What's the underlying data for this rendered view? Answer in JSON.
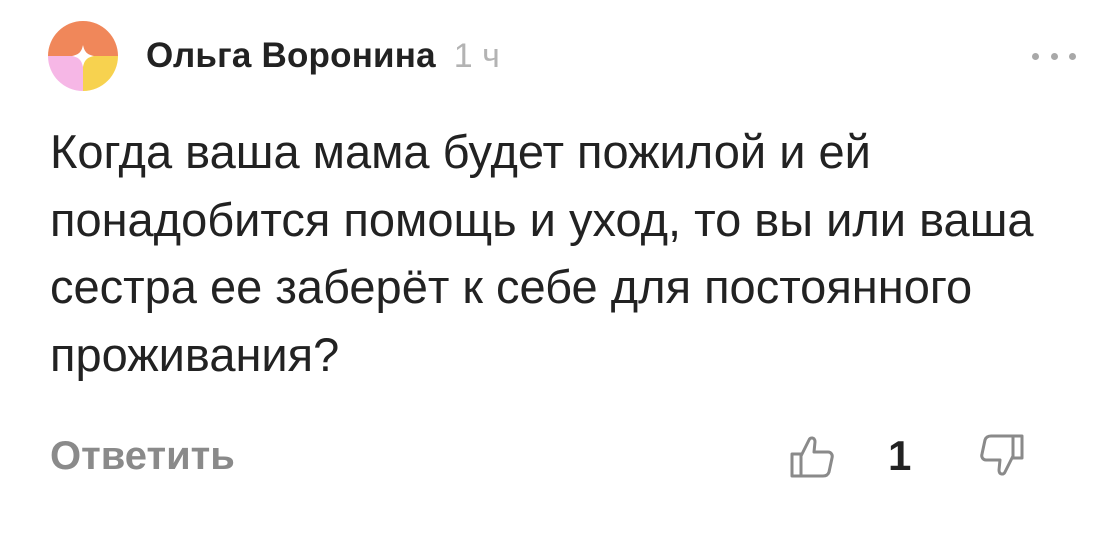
{
  "comment": {
    "author": "Ольга Воронина",
    "time": "1 ч",
    "text": "Когда ваша мама будет пожилой и ей понадобится помощь и уход, то вы или ваша сестра ее заберёт к себе для постоянного проживания?",
    "reply_label": "Ответить",
    "like_count": "1",
    "icons": {
      "avatar": "avatar-sparkle",
      "more": "more-dots-icon",
      "like": "thumbs-up-icon",
      "dislike": "thumbs-down-icon"
    },
    "colors": {
      "avatar_top": "#f0875a",
      "avatar_bottom_left": "#f6b7e6",
      "avatar_bottom_right": "#f7d24f",
      "muted_text": "#8a8a8a"
    }
  }
}
